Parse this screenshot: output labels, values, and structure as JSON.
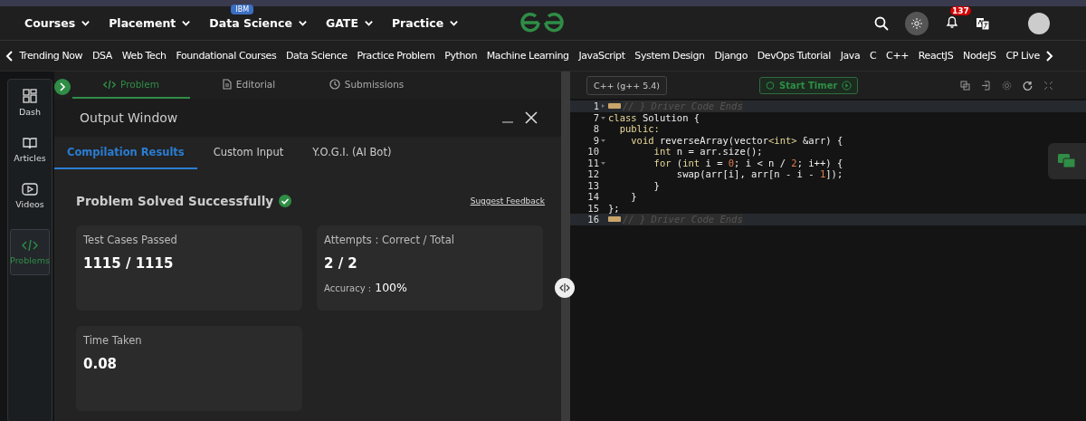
{
  "header": {
    "menus": [
      {
        "label": "Courses"
      },
      {
        "label": "Placement"
      },
      {
        "label": "Data Science",
        "badge": "IBM"
      },
      {
        "label": "GATE"
      },
      {
        "label": "Practice"
      }
    ],
    "notification_count": "137"
  },
  "nav": {
    "items": [
      "Trending Now",
      "DSA",
      "Web Tech",
      "Foundational Courses",
      "Data Science",
      "Practice Problem",
      "Python",
      "Machine Learning",
      "JavaScript",
      "System Design",
      "Django",
      "DevOps Tutorial",
      "Java",
      "C",
      "C++",
      "ReactJS",
      "NodeJS",
      "CP Live"
    ]
  },
  "sidebar": {
    "items": [
      {
        "label": "Dash",
        "kind": "dash",
        "selected": false
      },
      {
        "label": "Articles",
        "kind": "articles",
        "selected": false
      },
      {
        "label": "Videos",
        "kind": "videos",
        "selected": false
      },
      {
        "label": "Problems",
        "kind": "problems",
        "selected": true
      }
    ]
  },
  "problem_tabs": [
    {
      "label": "Problem",
      "kind": "code",
      "selected": true
    },
    {
      "label": "Editorial",
      "kind": "doc",
      "selected": false
    },
    {
      "label": "Submissions",
      "kind": "clock",
      "selected": false
    }
  ],
  "output_window": {
    "title": "Output Window",
    "tabs": [
      {
        "label": "Compilation Results",
        "selected": true
      },
      {
        "label": "Custom Input",
        "selected": false
      },
      {
        "label": "Y.O.G.I. (AI Bot)",
        "selected": false
      }
    ],
    "status": "Problem Solved Successfully",
    "feedback_link": "Suggest Feedback",
    "cards": [
      {
        "label": "Test Cases Passed",
        "value": "1115 / 1115"
      },
      {
        "label": "Attempts : Correct / Total",
        "value": "2 / 2",
        "sub_label": "Accuracy :",
        "sub_value": "100%"
      },
      {
        "label": "Time Taken",
        "value": "0.08"
      }
    ]
  },
  "editor": {
    "language": "C++ (g++ 5.4)",
    "timer_button": "Start Timer",
    "lines": [
      {
        "number": "1",
        "fold": true,
        "folded": true,
        "tokens": [
          {
            "text": "// } Driver Code Ends",
            "kind": "comment"
          }
        ]
      },
      {
        "number": "7",
        "fold": true,
        "folded": false,
        "tokens": [
          {
            "text": "class",
            "kind": "keyword"
          },
          {
            "text": " Solution {",
            "kind": "plain"
          }
        ]
      },
      {
        "number": "8",
        "fold": false,
        "folded": false,
        "tokens": [
          {
            "text": "  public:",
            "kind": "keyword"
          }
        ]
      },
      {
        "number": "9",
        "fold": true,
        "folded": false,
        "tokens": [
          {
            "text": "    void",
            "kind": "keyword"
          },
          {
            "text": " reverseArray(vector",
            "kind": "plain"
          },
          {
            "text": "<int>",
            "kind": "keyword"
          },
          {
            "text": " &arr) {",
            "kind": "plain"
          }
        ]
      },
      {
        "number": "10",
        "fold": false,
        "folded": false,
        "tokens": [
          {
            "text": "        int",
            "kind": "keyword"
          },
          {
            "text": " n = arr.size();",
            "kind": "plain"
          }
        ]
      },
      {
        "number": "11",
        "fold": true,
        "folded": false,
        "tokens": [
          {
            "text": "        for",
            "kind": "keyword"
          },
          {
            "text": " (",
            "kind": "plain"
          },
          {
            "text": "int",
            "kind": "keyword"
          },
          {
            "text": " i = ",
            "kind": "plain"
          },
          {
            "text": "0",
            "kind": "number"
          },
          {
            "text": "; i < n / ",
            "kind": "plain"
          },
          {
            "text": "2",
            "kind": "number"
          },
          {
            "text": "; i++) {",
            "kind": "plain"
          }
        ]
      },
      {
        "number": "12",
        "fold": false,
        "folded": false,
        "tokens": [
          {
            "text": "            swap(arr[i], arr[n - i - ",
            "kind": "plain"
          },
          {
            "text": "1",
            "kind": "number"
          },
          {
            "text": "]);",
            "kind": "plain"
          }
        ]
      },
      {
        "number": "13",
        "fold": false,
        "folded": false,
        "tokens": [
          {
            "text": "        }",
            "kind": "plain"
          }
        ]
      },
      {
        "number": "14",
        "fold": false,
        "folded": false,
        "tokens": [
          {
            "text": "    }",
            "kind": "plain"
          }
        ]
      },
      {
        "number": "15",
        "fold": false,
        "folded": false,
        "tokens": [
          {
            "text": "};",
            "kind": "plain"
          }
        ]
      },
      {
        "number": "16",
        "fold": false,
        "folded": true,
        "tokens": [
          {
            "text": "// } Driver Code Ends",
            "kind": "comment"
          }
        ]
      }
    ]
  }
}
